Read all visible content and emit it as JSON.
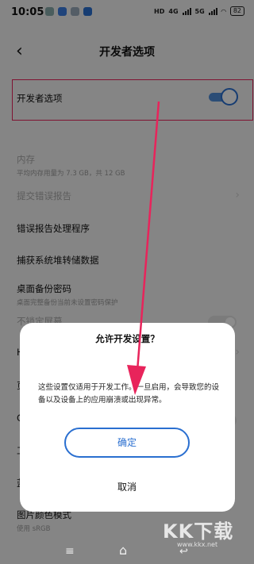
{
  "status_bar": {
    "time": "10:05",
    "network_left": "HD",
    "network_4g": "4G",
    "network_5g": "5G",
    "battery": "82"
  },
  "header": {
    "title": "开发者选项"
  },
  "developer_option": {
    "label": "开发者选项",
    "toggle_on": true
  },
  "settings": [
    {
      "title": "内存",
      "subtitle": "平均内存用量为 7.3 GB，共 12 GB",
      "disabled": true
    },
    {
      "title": "提交错误报告",
      "disabled": true
    },
    {
      "title": "错误报告处理程序"
    },
    {
      "title": "捕获系统堆转储数据"
    },
    {
      "title": "桌面备份密码",
      "subtitle": "桌面完整备份当前未设置密码保护"
    },
    {
      "title": "不锁定屏幕",
      "disabled": true
    }
  ],
  "partial_rows": {
    "row_a": "H",
    "row_b": "页",
    "row_c": "C",
    "row_d": "工",
    "row_e": "蓝",
    "last_title": "图片颜色模式",
    "last_subtitle": "使用 sRGB"
  },
  "dialog": {
    "title": "允许开发设置？",
    "message": "这些设置仅适用于开发工作。一旦启用，会导致您的设备以及设备上的应用崩溃或出现异常。",
    "confirm": "确定",
    "cancel": "取消"
  },
  "watermark": {
    "text": "KK下载",
    "url": "www.kkx.net"
  },
  "colors": {
    "accent": "#2a6fd0",
    "highlight": "#e8245b"
  }
}
